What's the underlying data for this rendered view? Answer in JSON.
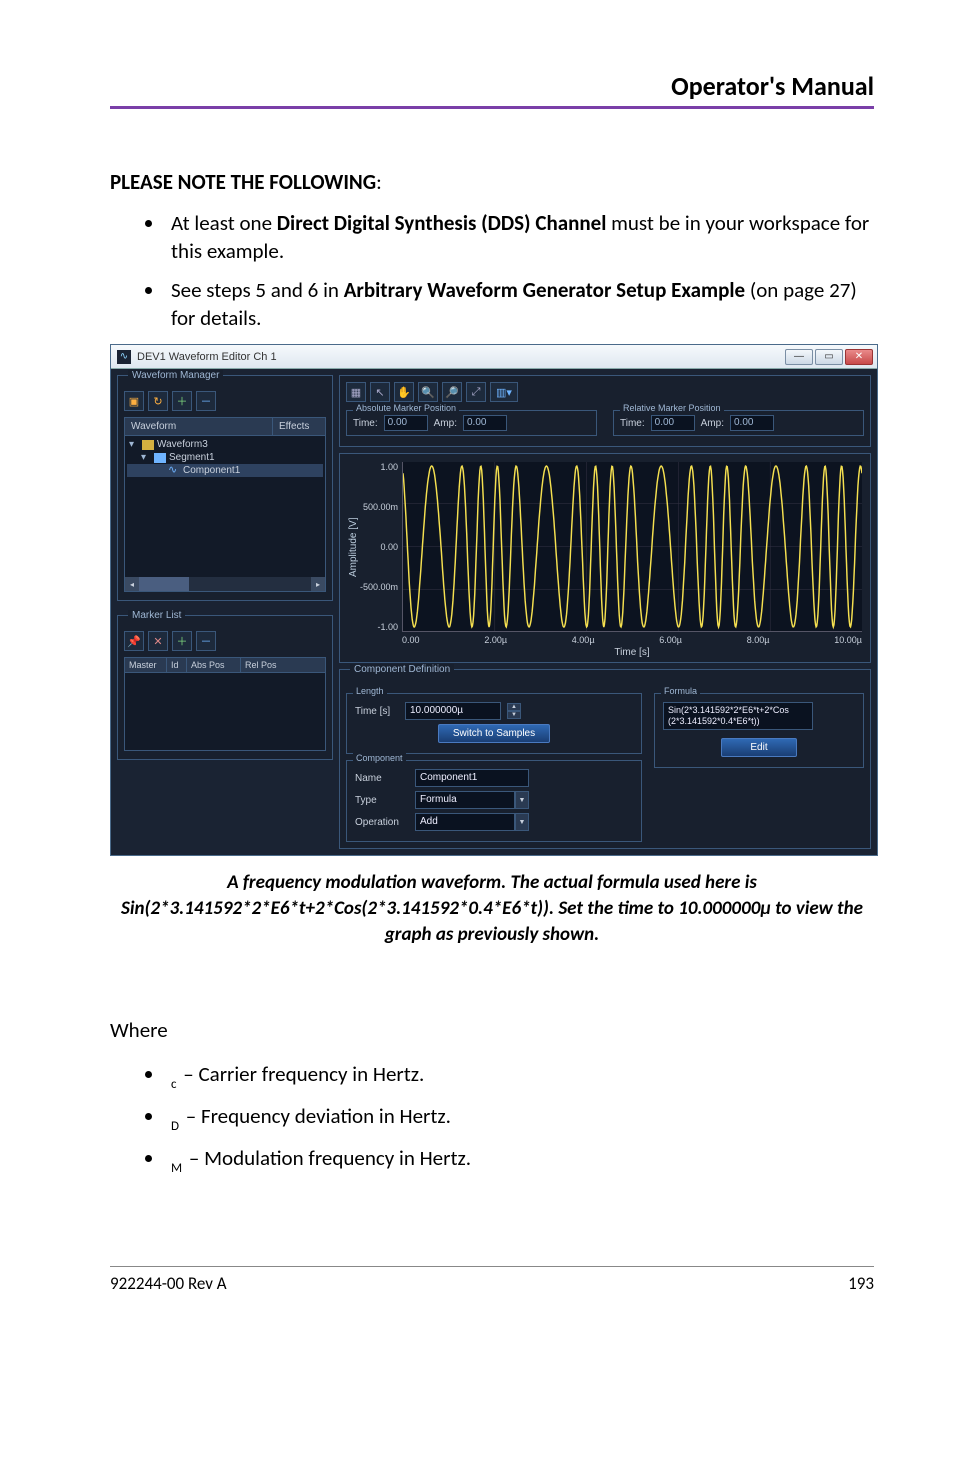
{
  "header": {
    "title": "Operator's Manual"
  },
  "note_heading_prefix": "PLEASE NOTE THE FOLLOWING",
  "note_heading_colon": ":",
  "bullets": {
    "b1_pre": "At least one ",
    "b1_bold": "Direct Digital Synthesis (DDS) Channel",
    "b1_post": " must be in your workspace for this example.",
    "b2_pre": "See steps 5 and 6 in ",
    "b2_bold": "Arbitrary Waveform Generator Setup Example",
    "b2_post": " (on page 27) for details."
  },
  "app": {
    "title": "DEV1 Waveform Editor Ch 1",
    "wm": {
      "panel_title": "Waveform Manager",
      "col_waveform": "Waveform",
      "col_effects": "Effects",
      "node0": "Waveform3",
      "node1": "Segment1",
      "node2": "Component1"
    },
    "ml": {
      "panel_title": "Marker List",
      "col_master": "Master",
      "col_id": "Id",
      "col_abspos": "Abs Pos",
      "col_relpos": "Rel Pos"
    },
    "abs_marker": {
      "title": "Absolute Marker Position",
      "time_label": "Time:",
      "time_val": "0.00",
      "amp_label": "Amp:",
      "amp_val": "0.00"
    },
    "rel_marker": {
      "title": "Relative Marker Position",
      "time_label": "Time:",
      "time_val": "0.00",
      "amp_label": "Amp:",
      "amp_val": "0.00"
    },
    "chart": {
      "y_label": "Amplitude [V]",
      "x_label": "Time [s]"
    },
    "compdef": {
      "title": "Component Definition",
      "length_title": "Length",
      "time_label": "Time [s]",
      "time_val": "10.000000µ",
      "switch_btn": "Switch to Samples",
      "formula_title": "Formula",
      "formula_line1": "Sin(2*3.141592*2*E6*t+2*Cos",
      "formula_line2": "(2*3.141592*0.4*E6*t))",
      "edit_btn": "Edit",
      "comp_title": "Component",
      "name_label": "Name",
      "name_val": "Component1",
      "type_label": "Type",
      "type_val": "Formula",
      "op_label": "Operation",
      "op_val": "Add"
    }
  },
  "chart_data": {
    "type": "line",
    "title": "",
    "xlabel": "Time [s]",
    "ylabel": "Amplitude [V]",
    "ylim": [
      -1.0,
      1.0
    ],
    "x_ticks": [
      "0.00",
      "2.00µ",
      "4.00µ",
      "6.00µ",
      "8.00µ",
      "10.00µ"
    ],
    "y_ticks": [
      "1.00",
      "500.00m",
      "0.00",
      "-500.00m",
      "-1.00"
    ],
    "series": [
      {
        "name": "Component1",
        "formula": "Sin(2*3.141592*2*E6*t+2*Cos(2*3.141592*0.4*E6*t))"
      }
    ]
  },
  "caption": "A frequency modulation waveform. The actual formula used here is Sin(2*3.141592*2*E6*t+2*Cos(2*3.141592*0.4*E6*t)). Set the time to 10.000000µ to view the graph as previously shown.",
  "where": {
    "heading": "Where",
    "items": {
      "c_sub": "c",
      "c_text": " – Carrier frequency in Hertz.",
      "d_sub": "D",
      "d_text": " – Frequency deviation in Hertz.",
      "m_sub": "M",
      "m_text": " – Modulation frequency in Hertz."
    }
  },
  "footer": {
    "rev": "922244-00 Rev A",
    "page": "193"
  }
}
